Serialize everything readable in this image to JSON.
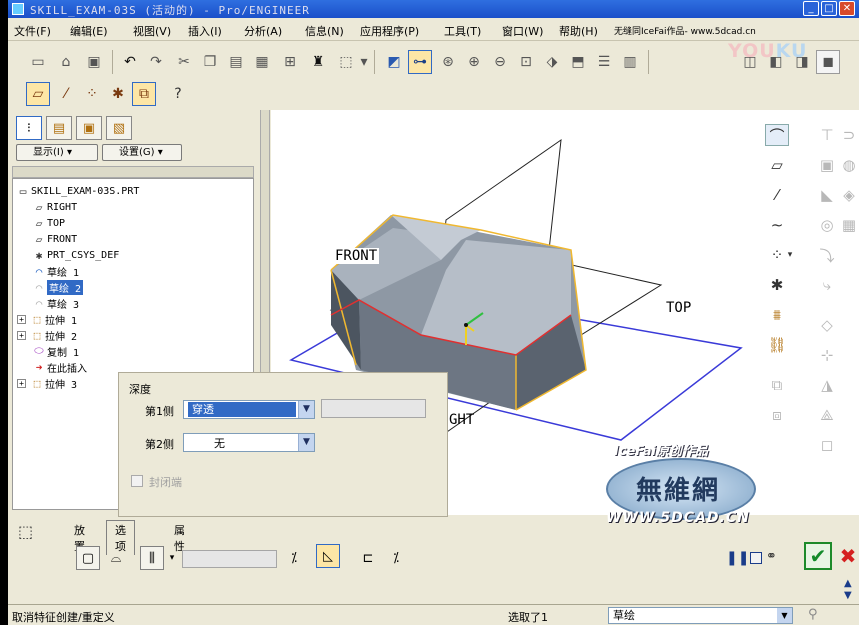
{
  "window": {
    "title": "SKILL_EXAM-03S (活动的) - Pro/ENGINEER",
    "btn_min": "_",
    "btn_max": "□",
    "btn_close": "✕"
  },
  "menu": [
    "文件(F)",
    "编辑(E)",
    "视图(V)",
    "插入(I)",
    "分析(A)",
    "信息(N)",
    "应用程序(P)",
    "工具(T)",
    "窗口(W)",
    "帮助(H)",
    "无缝同IceFai作品- www.5dcad.cn"
  ],
  "watermark": {
    "y1": "YOU",
    "y2": "KU"
  },
  "panel": {
    "show_label": "显示(I)",
    "settings_label": "设置(G)"
  },
  "tree": {
    "root": "SKILL_EXAM-03S.PRT",
    "items": [
      "RIGHT",
      "TOP",
      "FRONT",
      "PRT_CSYS_DEF",
      "草绘 1",
      "草绘 2",
      "草绘 3",
      "拉伸 1",
      "拉伸 2",
      "复制 1",
      "在此插入",
      "拉伸 3"
    ]
  },
  "viewport": {
    "label_front": "FRONT",
    "label_top": "TOP",
    "label_right": "GHT"
  },
  "depth_panel": {
    "title": "深度",
    "side1_label": "第1侧",
    "side1_value": "穿透",
    "side2_label": "第2侧",
    "side2_value": "无",
    "capped_label": "封闭端"
  },
  "dashboard": {
    "tab_placement": "放置",
    "tab_options": "选项",
    "tab_properties": "属性"
  },
  "logo": {
    "line1": "IceFai原创作品",
    "line2": "無維網",
    "line3": "WWW.5DCAD.CN"
  },
  "status": {
    "message": "取消特征创建/重定义",
    "selected": "选取了1",
    "filter_value": "草绘"
  },
  "colors": {
    "title_bar": "#1a4fc9",
    "selection": "#316ac5",
    "model_edge_yellow": "#f0b830",
    "model_edge_red": "#e03030",
    "datum_plane_blue": "#3a3ad8",
    "ok_green": "#128b2a",
    "cancel_red": "#d52020"
  }
}
